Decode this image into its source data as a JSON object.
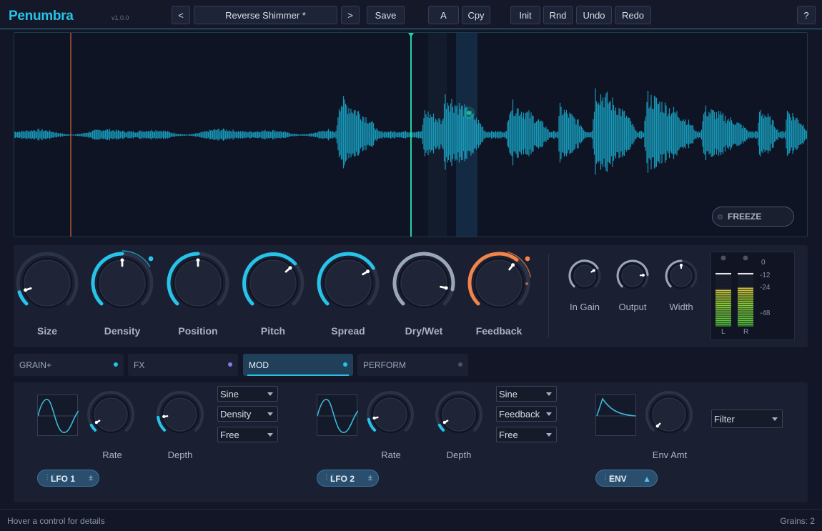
{
  "app": {
    "name": "Penumbra",
    "version": "v1.0.0"
  },
  "preset": {
    "prev_label": "<",
    "name": "Reverse Shimmer *",
    "next_label": ">"
  },
  "toolbar": {
    "save": "Save",
    "a": "A",
    "copy": "Cpy",
    "init": "Init",
    "random": "Rnd",
    "undo": "Undo",
    "redo": "Redo",
    "help": "?"
  },
  "waveform": {
    "freeze_label": "FREEZE",
    "accent": "#1aa6c8",
    "playhead_color": "#22d3a0",
    "start_marker_color": "#e06a3a"
  },
  "macros": [
    {
      "label": "Size",
      "value": 0.1,
      "color": "#27c3e8"
    },
    {
      "label": "Density",
      "value": 0.5,
      "color": "#27c3e8"
    },
    {
      "label": "Position",
      "value": 0.5,
      "color": "#27c3e8"
    },
    {
      "label": "Pitch",
      "value": 0.68,
      "color": "#27c3e8"
    },
    {
      "label": "Spread",
      "value": 0.72,
      "color": "#27c3e8"
    },
    {
      "label": "Dry/Wet",
      "value": 0.88,
      "color": "#9aa7b8"
    },
    {
      "label": "Feedback",
      "value": 0.64,
      "color": "#f0844a"
    }
  ],
  "output": [
    {
      "label": "In Gain",
      "value": 0.72
    },
    {
      "label": "Output",
      "value": 0.82
    },
    {
      "label": "Width",
      "value": 0.5
    }
  ],
  "meter": {
    "ticks": [
      "0",
      "-12",
      "-24",
      "-48"
    ],
    "left_label": "L",
    "right_label": "R",
    "left_level": 0.75,
    "right_level": 0.78
  },
  "tabs": [
    {
      "label": "GRAIN+",
      "dot": "#27c3e8"
    },
    {
      "label": "FX",
      "dot": "#8a78e8"
    },
    {
      "label": "MOD",
      "dot": "#27c3e8"
    },
    {
      "label": "PERFORM",
      "dot": "#4a5166"
    }
  ],
  "mod": {
    "lfo1": {
      "label": "LFO 1",
      "action": "±",
      "rate_label": "Rate",
      "depth_label": "Depth",
      "rate": 0.06,
      "depth": 0.14,
      "shape": "Sine",
      "target": "Density",
      "sync": "Free"
    },
    "lfo2": {
      "label": "LFO 2",
      "action": "±",
      "rate_label": "Rate",
      "depth_label": "Depth",
      "rate": 0.12,
      "depth": 0.06,
      "shape": "Sine",
      "target": "Feedback",
      "sync": "Free"
    },
    "env": {
      "label": "ENV",
      "action": "▲",
      "amt_label": "Env Amt",
      "amount": 0.0,
      "target": "Filter"
    }
  },
  "status": {
    "hint": "Hover a control for details",
    "grains": "Grains: 2"
  }
}
